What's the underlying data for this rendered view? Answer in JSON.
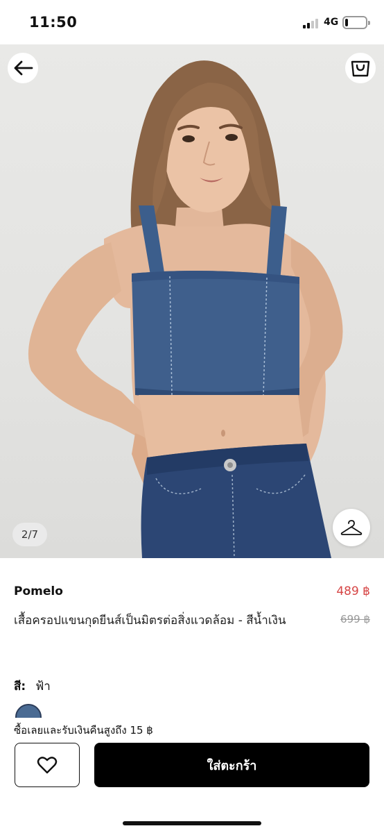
{
  "status_bar": {
    "time": "11:50",
    "network": "4G",
    "signal_bars": 4,
    "signal_bars_active": 2,
    "battery_level": 0.15
  },
  "gallery": {
    "counter": "2/7",
    "back_icon": "arrow-left-icon",
    "bag_icon": "shopping-bag-icon",
    "hanger_icon": "hanger-icon"
  },
  "product": {
    "brand": "Pomelo",
    "price": "489 ฿",
    "original_price": "699 ฿",
    "name": "เสื้อครอปแขนกุดยีนส์เป็นมิตรต่อสิ่งแวดล้อม - สีน้ำเงิน",
    "color_label": "สี:",
    "color_value": "ฟ้า"
  },
  "footer": {
    "cashback": "ซื้อเลยและรับเงินคืนสูงถึง 15 ฿",
    "wishlist_icon": "heart-icon",
    "add_to_cart": "ใส่ตะกร้า"
  },
  "colors": {
    "price_accent": "#d64545",
    "cta_background": "#000000",
    "denim": "#3f5f8c"
  }
}
